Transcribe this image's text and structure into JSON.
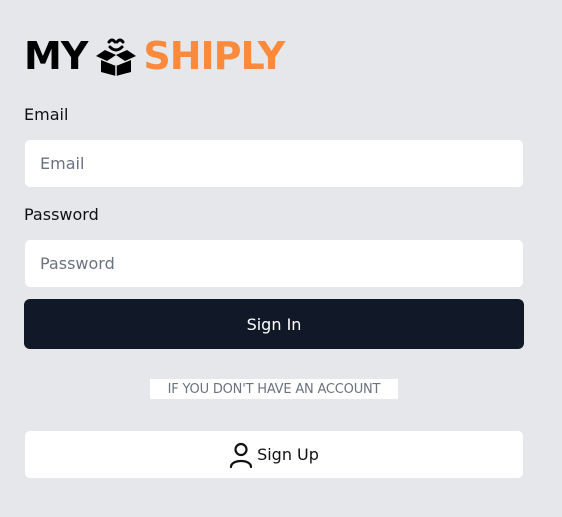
{
  "logo": {
    "part1": "MY",
    "part2": "SHIPLY",
    "icon": "smiling-box-icon"
  },
  "form": {
    "email_label": "Email",
    "email_placeholder": "Email",
    "email_value": "",
    "password_label": "Password",
    "password_placeholder": "Password",
    "password_value": "",
    "signin_label": "Sign In"
  },
  "divider_text": "IF YOU DON'T HAVE AN ACCOUNT",
  "signup": {
    "label": "Sign Up",
    "icon": "user-icon"
  },
  "colors": {
    "background": "#e5e7eb",
    "primary": "#111827",
    "accent": "#fb8a3c"
  }
}
